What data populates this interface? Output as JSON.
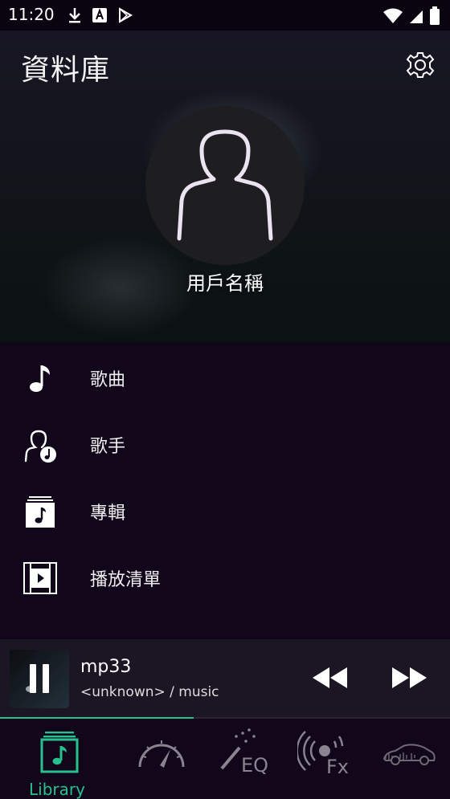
{
  "status": {
    "time": "11:20"
  },
  "header": {
    "title": "資料庫"
  },
  "profile": {
    "username": "用戶名稱"
  },
  "menu": {
    "items": [
      {
        "label": "歌曲"
      },
      {
        "label": "歌手"
      },
      {
        "label": "專輯"
      },
      {
        "label": "播放清單"
      }
    ]
  },
  "player": {
    "title": "mp33",
    "subtitle": "<unknown> / music",
    "progress": 0.43
  },
  "nav": {
    "items": [
      {
        "label": "Library",
        "icon": "library-icon",
        "active": true
      },
      {
        "label": "",
        "icon": "speedometer-icon"
      },
      {
        "label": "",
        "icon": "eq-icon"
      },
      {
        "label": "",
        "icon": "fx-icon"
      },
      {
        "label": "",
        "icon": "car-icon"
      }
    ]
  },
  "colors": {
    "accent": "#27c08f",
    "background": "#11061a",
    "player_bg": "#1c1524"
  }
}
